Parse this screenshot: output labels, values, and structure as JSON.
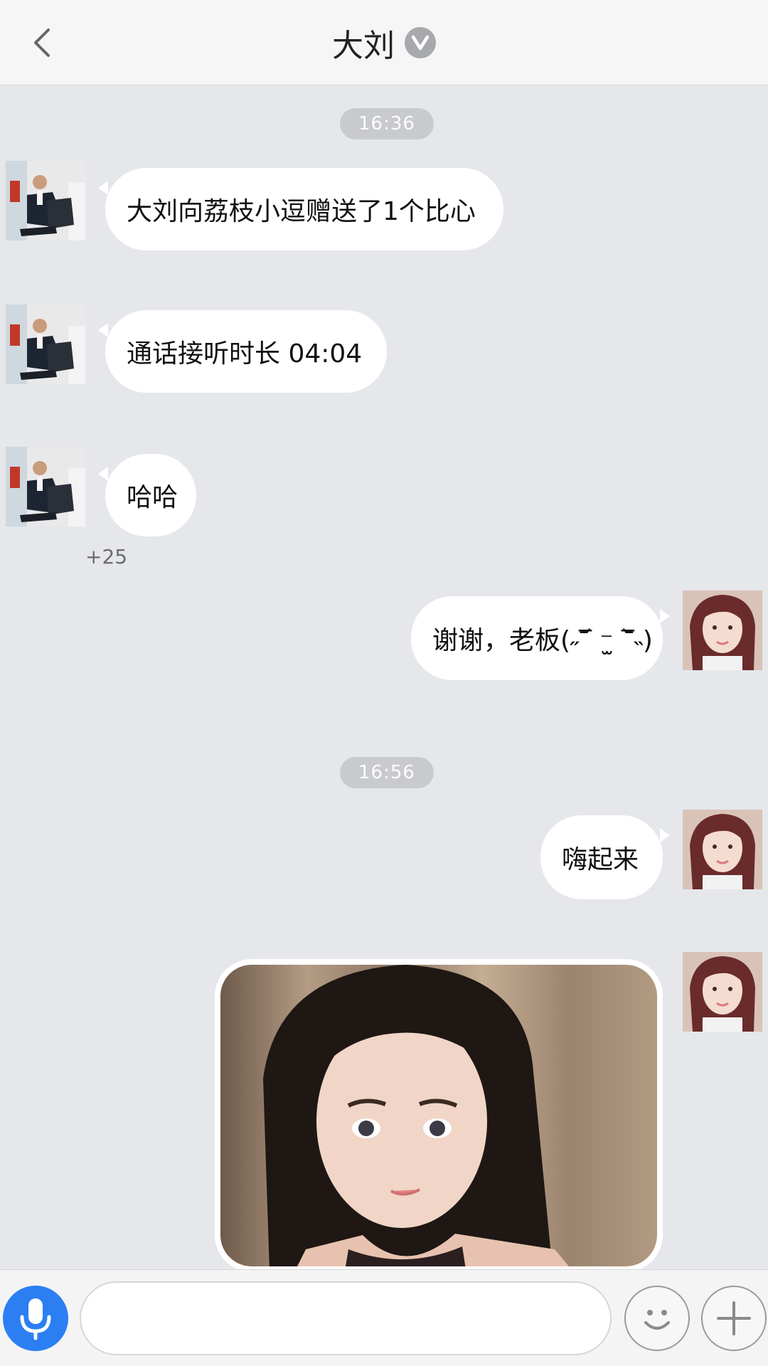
{
  "header": {
    "title": "大刘",
    "back_icon": "chevron-left-icon",
    "verified_icon": "v-badge-icon",
    "verified_letter": "V"
  },
  "messages": {
    "time1": "16:36",
    "m1": "大刘向荔枝小逗赠送了1个比心",
    "m2": "通话接听时长 04:04",
    "m3": "哈哈",
    "m3_likes": "+25",
    "m4": "谢谢，老板(˶‾᷄ ⁻̫ ‾᷅˵)",
    "time2": "16:56",
    "m5": "嗨起来"
  },
  "input_bar": {
    "placeholder": "",
    "mic_icon": "microphone-icon",
    "emoji_icon": "smiley-icon",
    "plus_icon": "plus-icon"
  },
  "colors": {
    "background": "#e5e7eb",
    "bubble": "#ffffff",
    "accent": "#2b7ff3",
    "timestamp_bg": "#c8cacd"
  }
}
